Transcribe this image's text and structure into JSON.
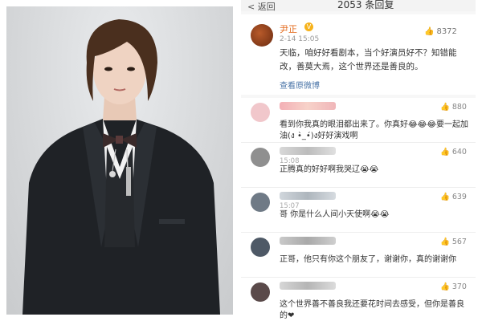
{
  "header": {
    "back_label": "< 返回",
    "title": "2053 条回复"
  },
  "post": {
    "author": "尹正",
    "verified_badge": "V",
    "date": "2-14 15:05",
    "likes": "8372",
    "text": "天临，咱好好看剧本，当个好演员好不？知错能改，善莫大焉，这个世界还是善良的。",
    "view_original": "查看原微博"
  },
  "comments": [
    {
      "time": "",
      "likes": "880",
      "text": "看到你我真的眼泪都出来了。你真好😂😂😂要一起加油(ง •̀_•́)ง好好演戏啊"
    },
    {
      "time": "15:08",
      "likes": "640",
      "text": "正腾真的好好啊我哭辽😭😭"
    },
    {
      "time": "15:07",
      "likes": "639",
      "text": "哥 你是什么人间小天使啊😭😭"
    },
    {
      "time": "",
      "likes": "567",
      "text": "正哥，他只有你这个朋友了，谢谢你，真的谢谢你"
    },
    {
      "time": "",
      "likes": "370",
      "text": "这个世界善不善良我还要花时间去感受，但你是善良的❤"
    }
  ],
  "colors": {
    "author": "#e36a1c",
    "link": "#4b75a8",
    "like_icon": "#888888"
  }
}
